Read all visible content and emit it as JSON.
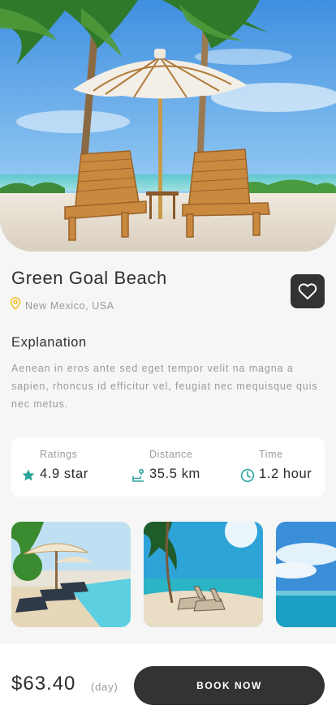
{
  "place": {
    "title": "Green Goal Beach",
    "location": "New Mexico, USA"
  },
  "favorite": {
    "icon": "heart-outline-icon"
  },
  "explanation": {
    "heading": "Explanation",
    "text": "Aenean in eros ante sed eget tempor velit na magna a sapien, rhoncus id efficitur vel, feugiat nec mequisque quis nec metus."
  },
  "stats": [
    {
      "label": "Ratings",
      "value": "4.9 star",
      "icon": "star-icon"
    },
    {
      "label": "Distance",
      "value": "35.5 km",
      "icon": "route-icon"
    },
    {
      "label": "Time",
      "value": "1.2 hour",
      "icon": "clock-icon"
    }
  ],
  "gallery": [
    {
      "icon": "resort-pool-photo"
    },
    {
      "icon": "beach-chairs-photo"
    },
    {
      "icon": "ocean-sky-photo"
    }
  ],
  "booking": {
    "price": "$63.40",
    "unit": "(day)",
    "button_label": "BOOK NOW"
  },
  "colors": {
    "accent_teal": "#2aa59a",
    "pin_yellow": "#f2c230",
    "dark": "#333333",
    "muted": "#9a9a9a"
  }
}
